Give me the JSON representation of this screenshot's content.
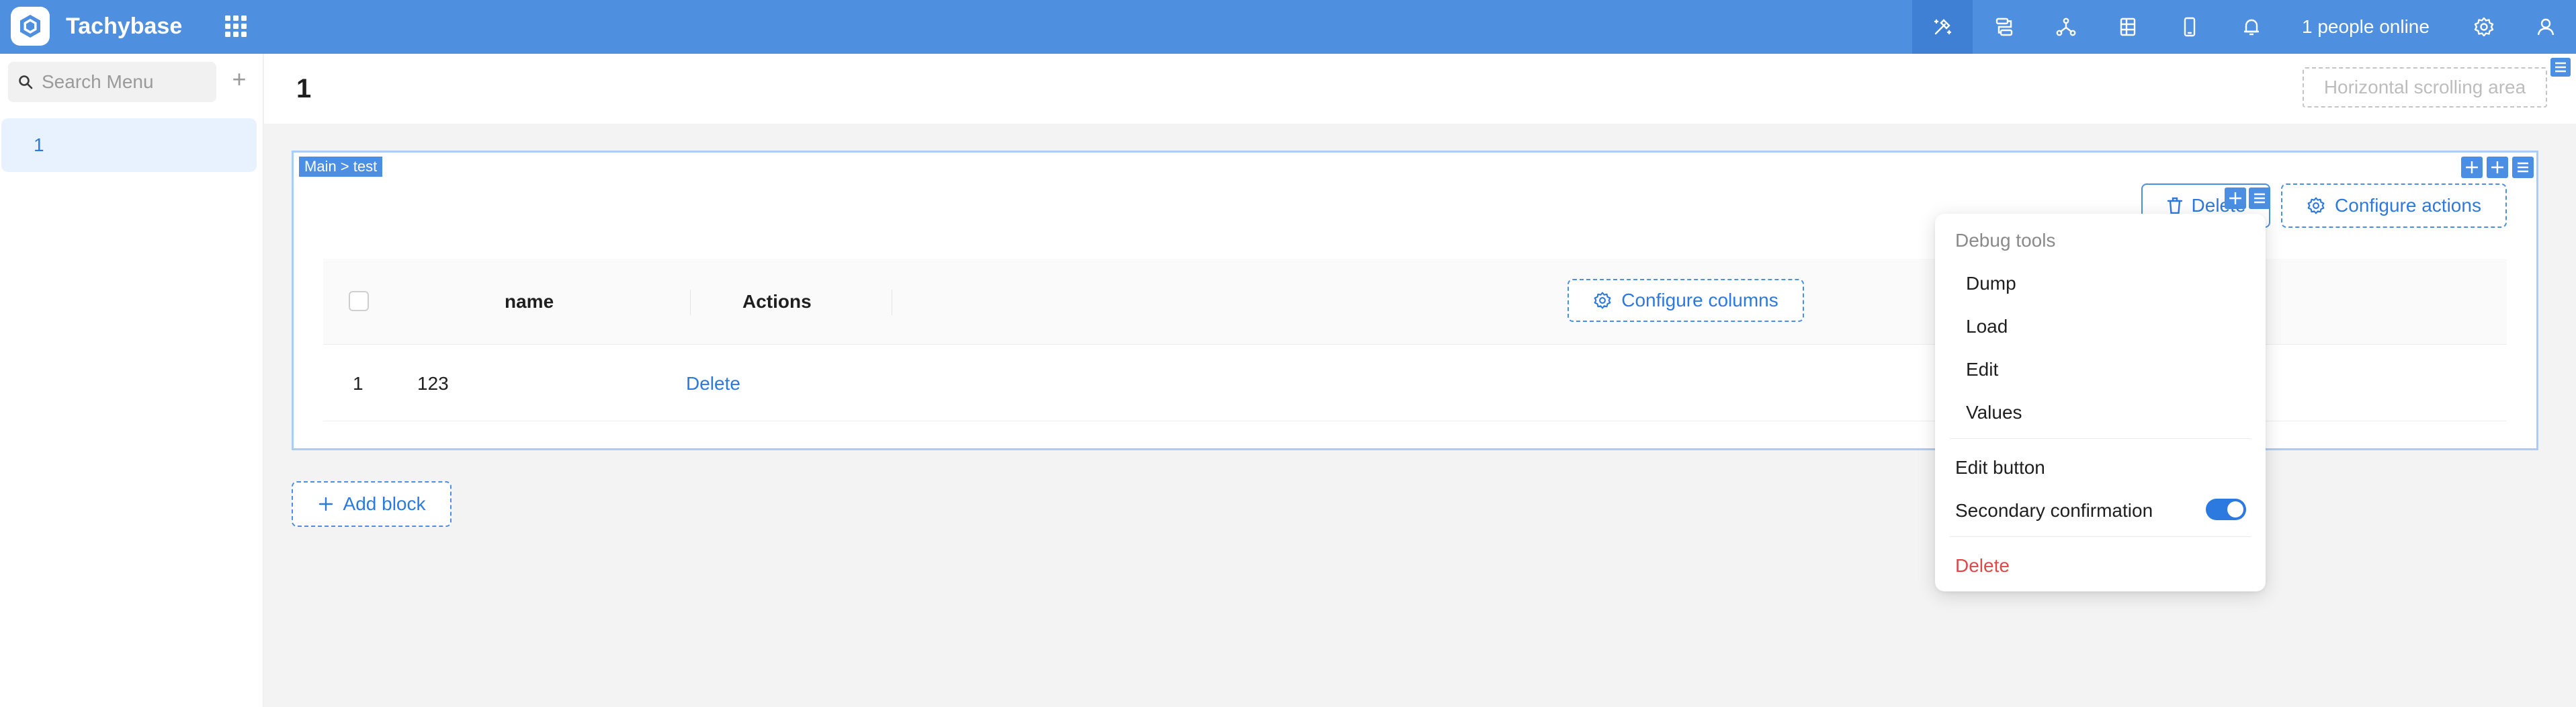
{
  "app": {
    "brand": "Tachybase",
    "online_status": "1 people online",
    "colors": {
      "topbar": "#4f8fe0",
      "accent": "#2c79e0",
      "danger": "#e0484a"
    }
  },
  "topbar": {
    "icons": [
      "design-mode-icon",
      "workflow-icon",
      "graph-icon",
      "table-icon",
      "mobile-icon",
      "bell-icon",
      "settings-icon",
      "user-icon"
    ]
  },
  "sidebar": {
    "search_placeholder": "Search Menu",
    "add_symbol": "+",
    "items": [
      {
        "label": "1",
        "selected": true
      }
    ]
  },
  "page": {
    "title": "1",
    "scroll_area_label": "Horizontal scrolling area"
  },
  "block": {
    "tag": "Main > test",
    "actions": {
      "delete_label": "Delete",
      "configure_actions_label": "Configure actions"
    },
    "table": {
      "headers": {
        "name": "name",
        "actions": "Actions"
      },
      "configure_columns_label": "Configure columns",
      "rows": [
        {
          "index": "1",
          "name": "123",
          "action": "Delete"
        }
      ]
    }
  },
  "add_block_label": "Add block",
  "dropdown": {
    "group_title": "Debug tools",
    "debug_items": [
      "Dump",
      "Load",
      "Edit",
      "Values"
    ],
    "edit_button": "Edit button",
    "secondary_confirmation": "Secondary confirmation",
    "secondary_confirmation_on": true,
    "delete": "Delete"
  }
}
